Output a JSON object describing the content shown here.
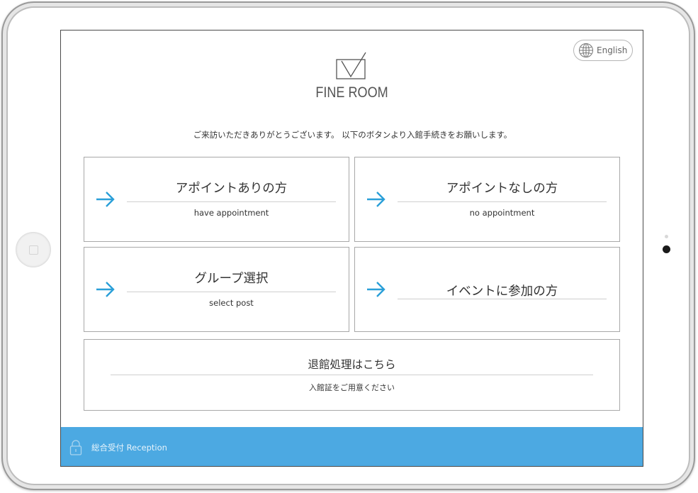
{
  "header": {
    "language_button": "English",
    "brand": "FINE ROOM",
    "welcome": "ご来訪いただきありがとうございます。 以下のボタンより入館手続きをお願いします。"
  },
  "options": [
    {
      "title": "アポイントありの方",
      "subtitle": "have appointment"
    },
    {
      "title": "アポイントなしの方",
      "subtitle": "no appointment"
    },
    {
      "title": "グループ選択",
      "subtitle": "select post"
    },
    {
      "title": "イベントに参加の方",
      "subtitle": ""
    }
  ],
  "checkout": {
    "title": "退館処理はこちら",
    "subtitle": "入館証をご用意ください"
  },
  "footer": {
    "label": "総合受付 Reception"
  },
  "colors": {
    "accent_arrow": "#2a9fd8",
    "footer_bar": "#4ca9e2",
    "card_border": "#a8a8a8"
  },
  "icons": {
    "language": "globe-icon",
    "logo": "checkbox-logo-icon",
    "arrow": "arrow-right-icon",
    "footer": "lock-icon"
  }
}
